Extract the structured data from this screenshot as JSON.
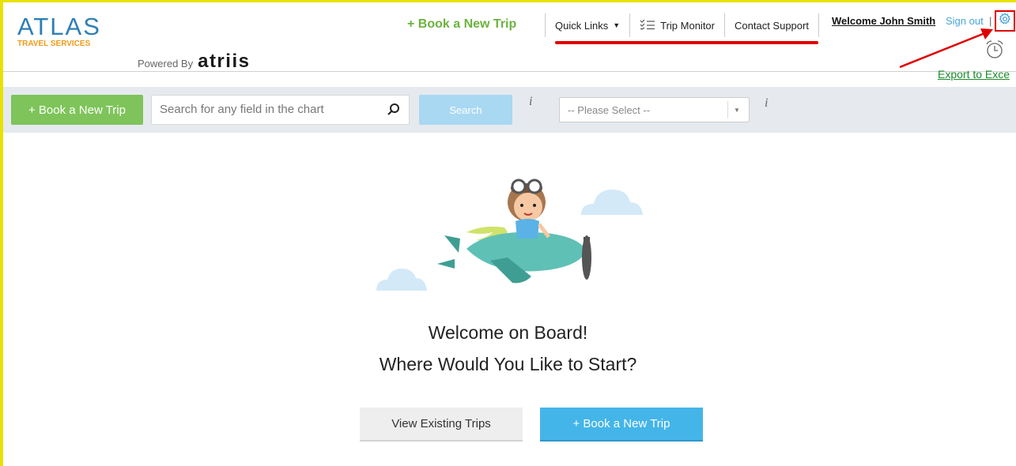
{
  "logo": {
    "main": "ATLAS",
    "sub": "TRAVEL SERVICES"
  },
  "powered": {
    "label": "Powered By",
    "brand": "atriis"
  },
  "header": {
    "book_link": "+ Book a New Trip",
    "nav": [
      {
        "label": "Quick Links",
        "icon": "caret-down-icon"
      },
      {
        "label": "Trip Monitor",
        "icon": "checklist-icon"
      },
      {
        "label": "Contact Support"
      }
    ],
    "welcome": "Welcome John Smith",
    "sign_out": "Sign out",
    "separator": "|",
    "export": "Export to Exce"
  },
  "toolbar": {
    "book_button": "+ Book a New Trip",
    "search_placeholder": "Search for any field in the chart",
    "search_button": "Search",
    "info_symbol": "i",
    "select_value": "-- Please Select --"
  },
  "hero": {
    "line1": "Welcome on Board!",
    "line2": "Where Would You Like to Start?",
    "view_button": "View Existing Trips",
    "book_button": "+ Book a New Trip"
  },
  "colors": {
    "accent_green": "#6cb33f",
    "button_green": "#7ec45a",
    "primary_blue": "#44b5e8",
    "annotation_red": "#e00000",
    "frame_yellow": "#e8e200"
  }
}
